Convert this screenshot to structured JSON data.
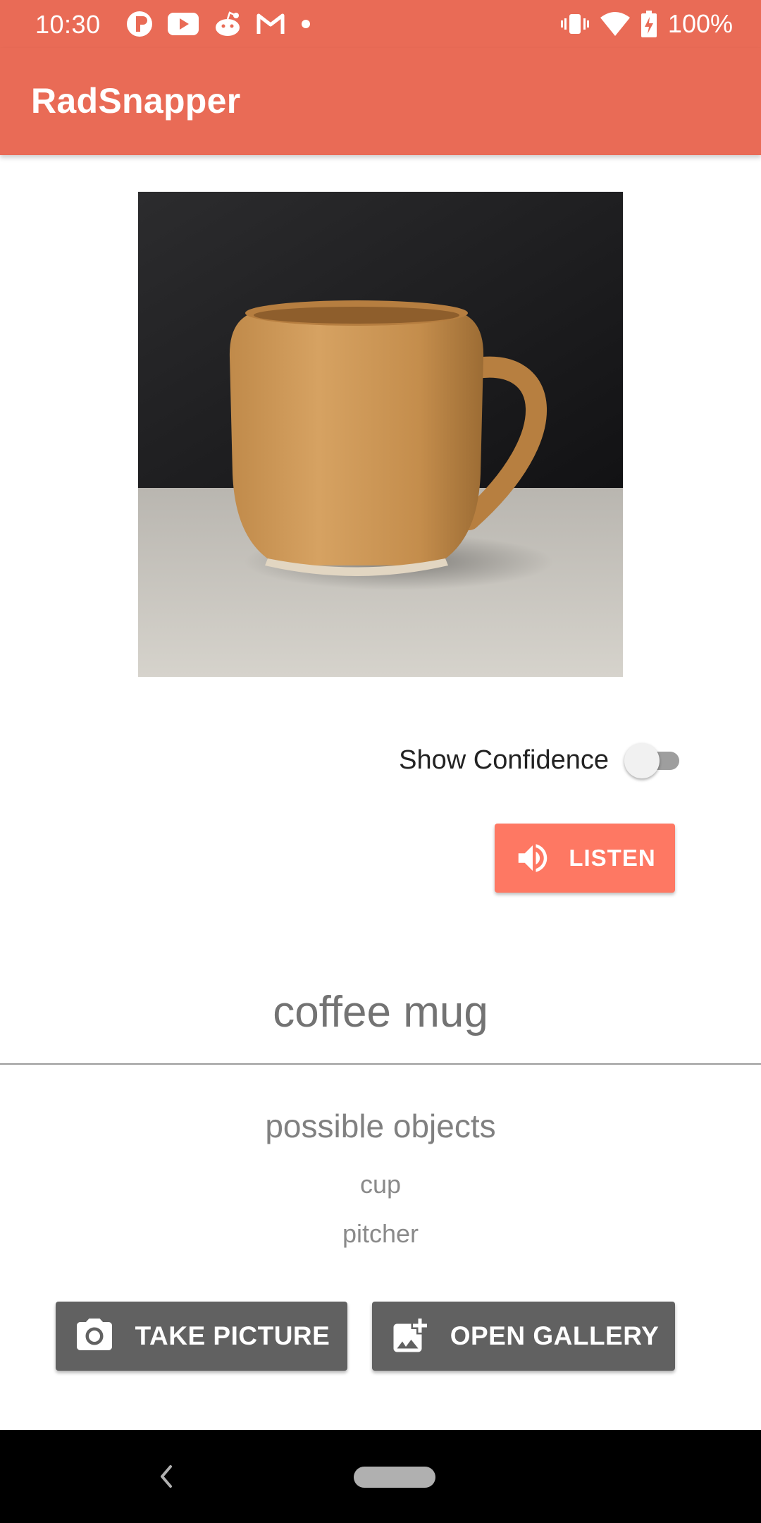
{
  "theme": {
    "accent": "#e96b56",
    "listen_color": "#fe7863",
    "action_color": "#616161"
  },
  "status_bar": {
    "time": "10:30",
    "battery": "100%",
    "left_icons": [
      "tasker-icon",
      "youtube-icon",
      "reddit-icon",
      "gmail-icon",
      "notification-dot-icon"
    ],
    "right_icons": [
      "vibrate-icon",
      "wifi-icon",
      "battery-charging-icon"
    ]
  },
  "app_bar": {
    "title": "RadSnapper"
  },
  "confidence": {
    "label": "Show Confidence",
    "enabled": false
  },
  "listen_button": {
    "label": "LISTEN"
  },
  "prediction": {
    "label": "coffee mug"
  },
  "possible": {
    "heading": "possible objects",
    "items": [
      "cup",
      "pitcher"
    ]
  },
  "actions": {
    "take_picture": "TAKE PICTURE",
    "open_gallery": "OPEN GALLERY"
  },
  "nav_bar": {
    "icons": [
      "back-icon",
      "home-pill-icon"
    ]
  }
}
